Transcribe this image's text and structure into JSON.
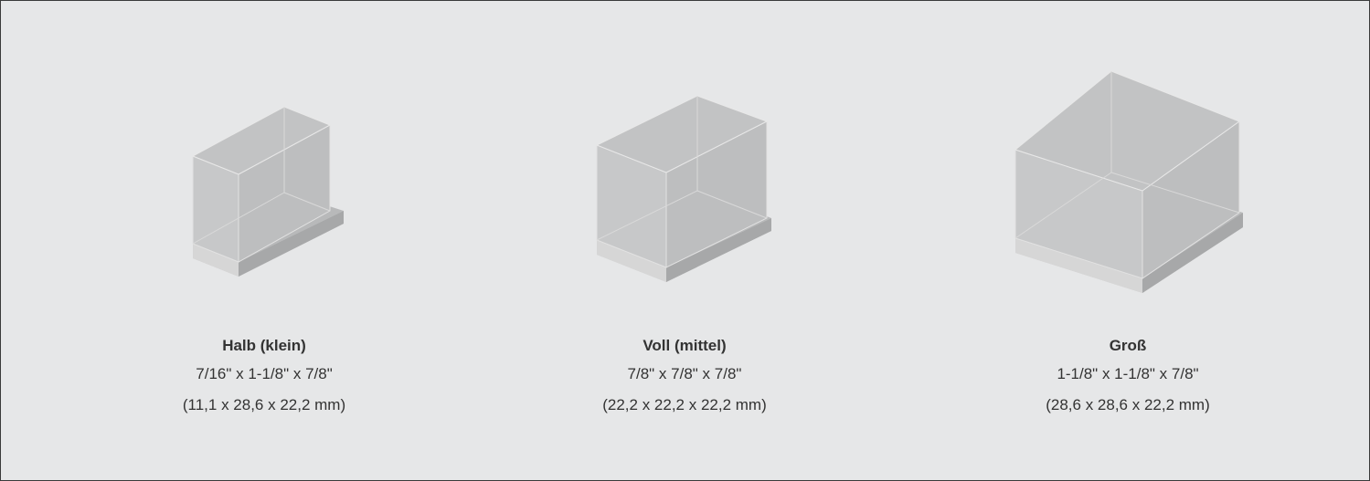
{
  "items": [
    {
      "name": "Halb (klein)",
      "size_imperial": "7/16\" x 1-1/8\" x 7/8\"",
      "size_metric": "(11,1 x 28,6 x 22,2 mm)",
      "icon": "clear-box-small-icon"
    },
    {
      "name": "Voll (mittel)",
      "size_imperial": "7/8\" x 7/8\" x 7/8\"",
      "size_metric": "(22,2 x 22,2 x 22,2 mm)",
      "icon": "clear-box-medium-icon"
    },
    {
      "name": "Groß",
      "size_imperial": "1-1/8\" x 1-1/8\" x 7/8\"",
      "size_metric": "(28,6 x 28,6 x 22,2 mm)",
      "icon": "clear-box-large-icon"
    }
  ],
  "colors": {
    "background": "#e6e7e8",
    "text": "#333333",
    "border": "#3a3a3a"
  }
}
